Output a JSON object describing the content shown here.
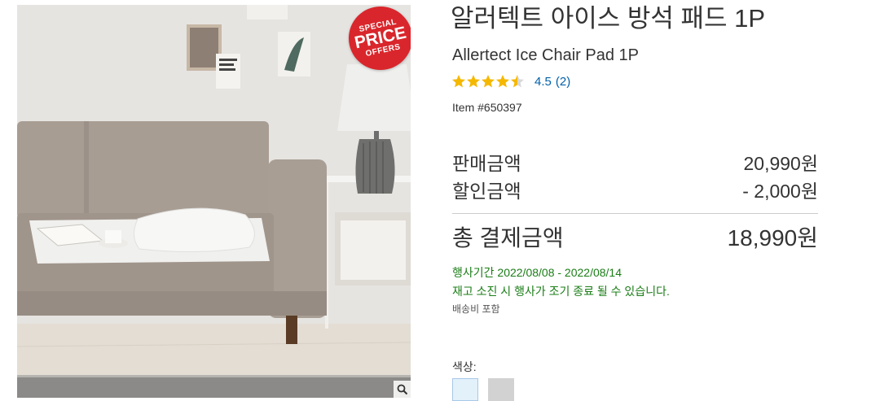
{
  "product": {
    "title_ko": "알러텍트 아이스 방석 패드 1P",
    "title_en": "Allertect Ice Chair Pad 1P",
    "rating": {
      "stars": 4.5,
      "value_text": "4.5",
      "count_text": "(2)",
      "star_color": "#f5b800"
    },
    "item_number": "Item #650397"
  },
  "image": {
    "badge": {
      "line1": "SPECIAL",
      "line2": "PRICE",
      "line3": "OFFERS",
      "color": "#d9262c"
    },
    "zoom_icon": "magnifier-icon"
  },
  "pricing": {
    "sale_label": "판매금액",
    "sale_value": "20,990원",
    "discount_label": "할인금액",
    "discount_value": "- 2,000원",
    "total_label": "총 결제금액",
    "total_value": "18,990원"
  },
  "promotion": {
    "period": "행사기간 2022/08/08 - 2022/08/14",
    "note": "재고 소진 시 행사가 조기 종료 될 수 있습니다.",
    "shipping": "배송비 포함",
    "accent_color": "#1a7d16"
  },
  "options": {
    "color_label": "색상:",
    "swatches": [
      {
        "name": "light-blue",
        "color": "#e3f1fb",
        "selected": true
      },
      {
        "name": "gray",
        "color": "#d2d2d2",
        "selected": false
      }
    ]
  }
}
